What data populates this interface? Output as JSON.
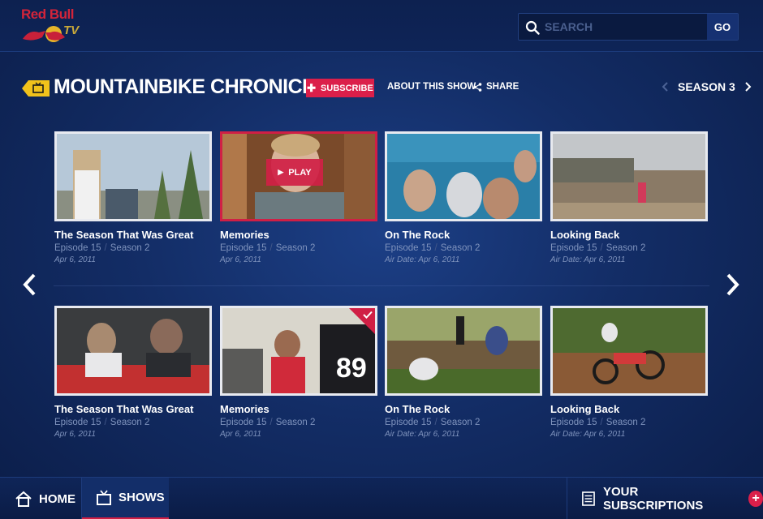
{
  "brand": {
    "name": "Red Bull",
    "tv": "TV"
  },
  "search": {
    "placeholder": "SEARCH",
    "go_label": "GO"
  },
  "show": {
    "title": "MOUNTAINBIKE CHRONICLES",
    "subscribe_label": "SUBSCRIBE",
    "about_label": "ABOUT THIS SHOW",
    "share_label": "SHARE",
    "season_label": "SEASON 3"
  },
  "episodes": [
    {
      "title": "The Season That Was Great",
      "episode": "Episode 15",
      "season": "Season 2",
      "date": "Apr 6, 2011"
    },
    {
      "title": "Memories",
      "episode": "Episode 15",
      "season": "Season 2",
      "date": "Apr 6, 2011",
      "play_label": "PLAY"
    },
    {
      "title": "On The Rock",
      "episode": "Episode 15",
      "season": "Season 2",
      "date": "Air Date: Apr 6, 2011"
    },
    {
      "title": "Looking Back",
      "episode": "Episode 15",
      "season": "Season 2",
      "date": "Air Date: Apr 6, 2011"
    },
    {
      "title": "The Season That Was Great",
      "episode": "Episode 15",
      "season": "Season 2",
      "date": "Apr 6, 2011"
    },
    {
      "title": "Memories",
      "episode": "Episode 15",
      "season": "Season 2",
      "date": "Apr 6, 2011"
    },
    {
      "title": "On The Rock",
      "episode": "Episode 15",
      "season": "Season 2",
      "date": "Air Date: Apr 6, 2011"
    },
    {
      "title": "Looking Back",
      "episode": "Episode 15",
      "season": "Season 2",
      "date": "Air Date: Apr 6, 2011"
    }
  ],
  "bottom_nav": {
    "home": "HOME",
    "shows": "SHOWS",
    "subscriptions": "YOUR SUBSCRIPTIONS",
    "subscriptions_add": "+"
  },
  "colors": {
    "accent": "#db1f4a",
    "background": "#132d66",
    "meta": "#7f93bd"
  },
  "icons": [
    "search-icon",
    "tv-icon",
    "share-icon",
    "chevron-left-icon",
    "chevron-right-icon",
    "play-icon",
    "checkmark-icon",
    "home-icon",
    "list-icon",
    "plus-icon"
  ]
}
